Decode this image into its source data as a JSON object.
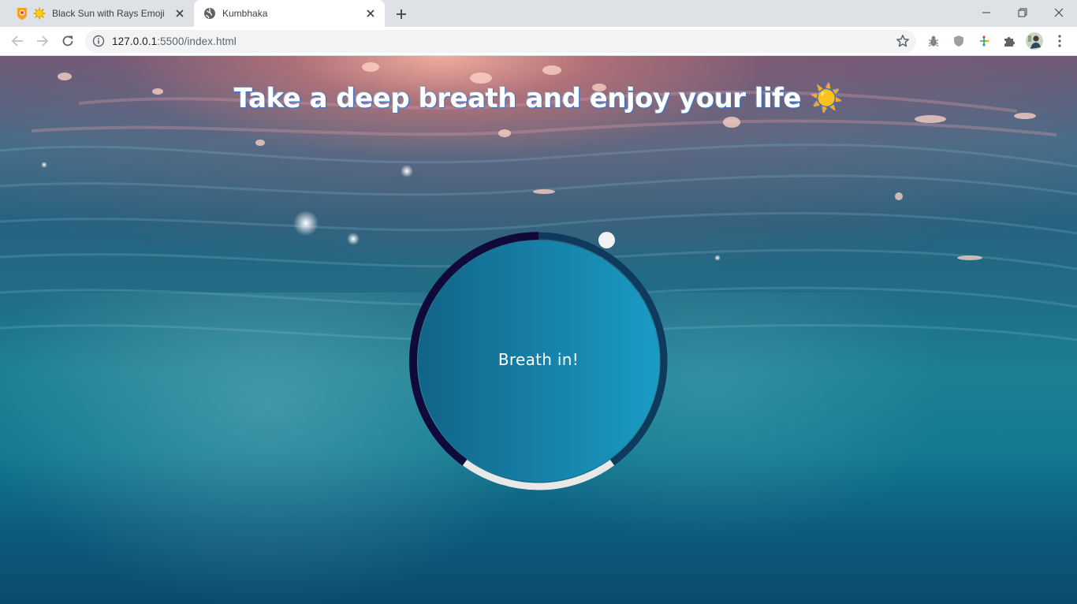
{
  "browser": {
    "tabs": [
      {
        "title": "Black Sun with Rays Emoji",
        "active": false,
        "icons": [
          "emojipedia-icon",
          "sun-emoji-icon"
        ]
      },
      {
        "title": "Kumbhaka",
        "active": true,
        "icons": [
          "globe-icon"
        ]
      }
    ],
    "address": {
      "host": "127.0.0.1",
      "rest": ":5500/index.html"
    }
  },
  "page": {
    "headline": "Take a deep breath and enjoy your life ☀️",
    "breath_label": "Breath in!",
    "colors": {
      "ring_dark": "#0f0a3a",
      "ring_track": "#0e3a5e",
      "ring_light": "#e8e8e8",
      "circle_from": "#126487",
      "circle_to": "#1a9cc6"
    }
  }
}
